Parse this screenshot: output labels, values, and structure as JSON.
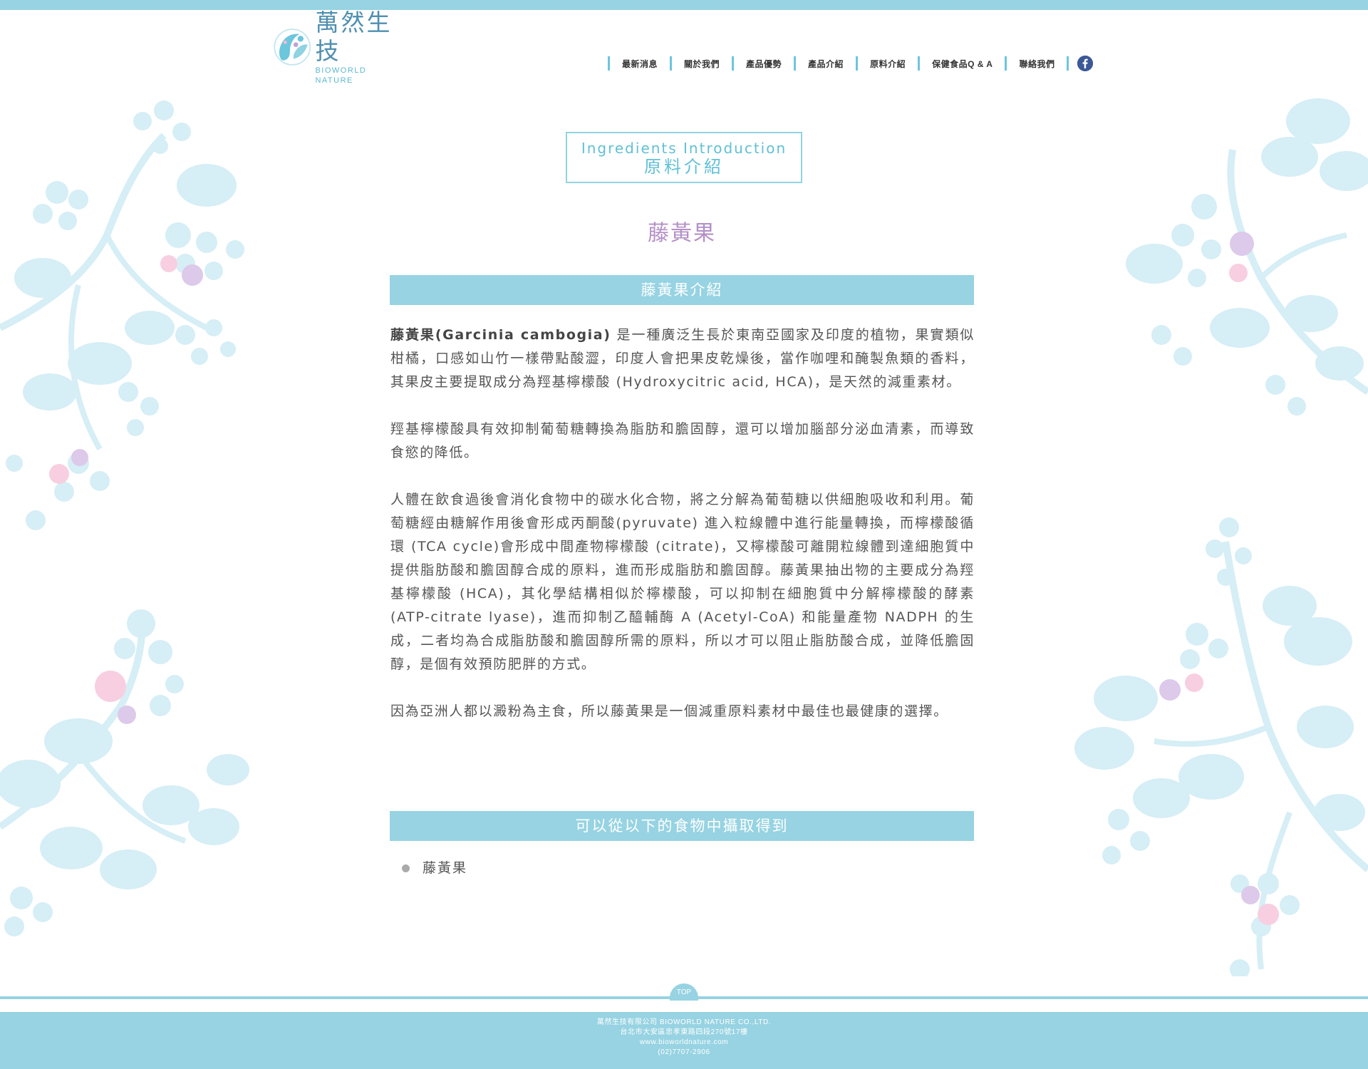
{
  "brand": {
    "name_cn": "萬然生技",
    "name_en": "BIOWORLD NATURE"
  },
  "nav": {
    "items": [
      {
        "label": "最新消息"
      },
      {
        "label": "關於我們"
      },
      {
        "label": "產品優勢"
      },
      {
        "label": "產品介紹"
      },
      {
        "label": "原料介紹"
      },
      {
        "label": "保健食品Q & A"
      },
      {
        "label": "聯絡我們"
      }
    ],
    "social_icon": "facebook-icon"
  },
  "page": {
    "title_en": "Ingredients Introduction",
    "title_cn": "原料介紹",
    "item_name": "藤黃果"
  },
  "sections": {
    "intro_heading": "藤黃果介紹",
    "food_heading": "可以從以下的食物中攝取得到"
  },
  "content": {
    "p1_lead": "藤黃果(Garcinia cambogia)",
    "p1_rest": " 是一種廣泛生長於東南亞國家及印度的植物，果實類似柑橘，口感如山竹一樣帶點酸澀，印度人會把果皮乾燥後，當作咖哩和醃製魚類的香料，其果皮主要提取成分為羥基檸檬酸 (Hydroxycitric acid, HCA)，是天然的減重素材。",
    "p2": "羥基檸檬酸具有效抑制葡萄糖轉換為脂肪和膽固醇，還可以增加腦部分泌血清素，而導致食慾的降低。",
    "p3": "人體在飲食過後會消化食物中的碳水化合物，將之分解為葡萄糖以供細胞吸收和利用。葡萄糖經由糖解作用後會形成丙酮酸(pyruvate) 進入粒線體中進行能量轉換，而檸檬酸循環 (TCA cycle)會形成中間產物檸檬酸 (citrate)，又檸檬酸可離開粒線體到達細胞質中提供脂肪酸和膽固醇合成的原料，進而形成脂肪和膽固醇。藤黃果抽出物的主要成分為羥基檸檬酸 (HCA)，其化學結構相似於檸檬酸，可以抑制在細胞質中分解檸檬酸的酵素 (ATP-citrate lyase)，進而抑制乙醯輔酶 A (Acetyl-CoA) 和能量產物 NADPH 的生成，二者均為合成脂肪酸和膽固醇所需的原料，所以才可以阻止脂肪酸合成，並降低膽固醇，是個有效預防肥胖的方式。",
    "p4": "因為亞洲人都以澱粉為主食，所以藤黃果是一個減重原料素材中最佳也最健康的選擇。"
  },
  "food_list": [
    {
      "label": "藤黃果"
    }
  ],
  "footer": {
    "top_label": "TOP",
    "company": "萬然生技有限公司 BIOWORLD NATURE CO.,LTD.",
    "address": "台北市大安區忠孝東路四段270號17樓",
    "website": "www.bioworldnature.com",
    "phone": "(02)7707-2906"
  },
  "colors": {
    "accent": "#97d3e2",
    "title_accent": "#61c0d6",
    "item_title": "#b48fc7",
    "deco_leaf": "#d6eef5",
    "deco_pink": "#f7cfe0",
    "deco_purple": "#ddc9ea",
    "facebook": "#3b5998"
  }
}
